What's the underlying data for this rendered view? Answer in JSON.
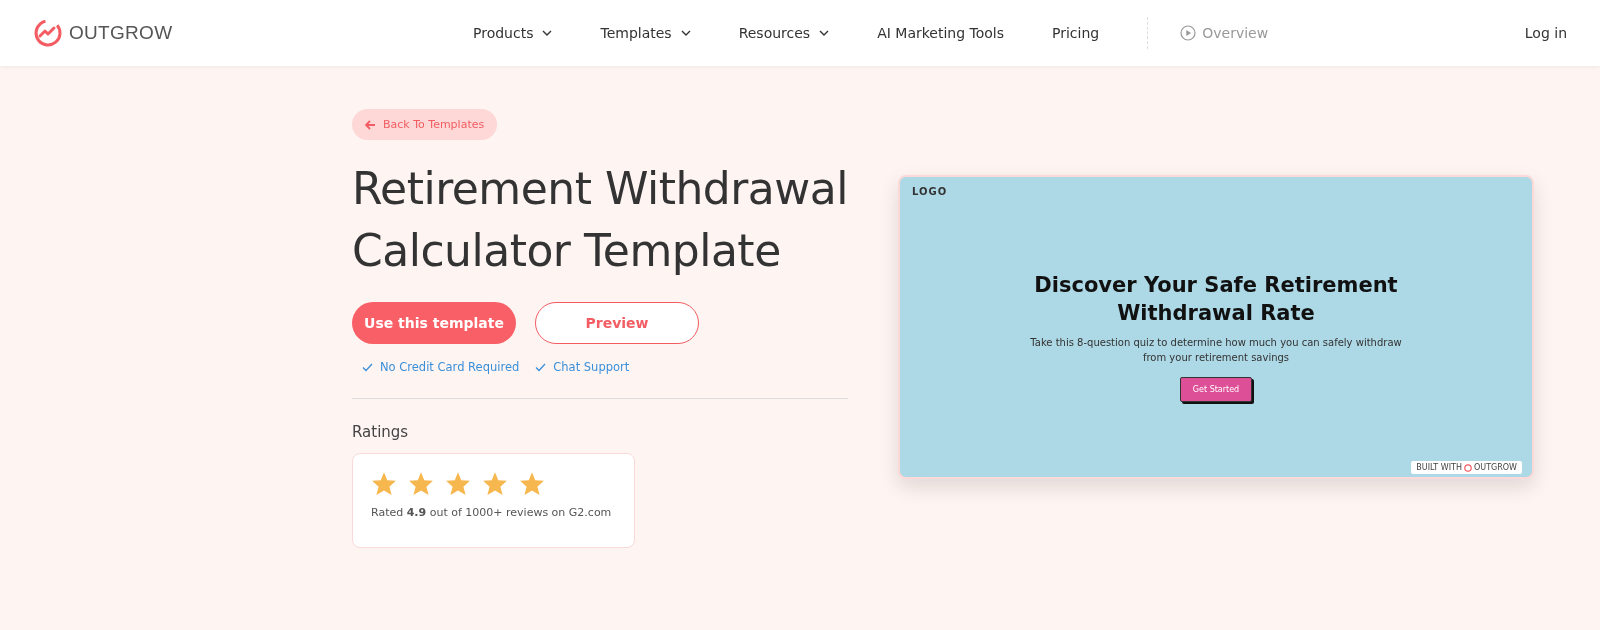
{
  "header": {
    "brand": "OUTGROW",
    "nav": [
      {
        "label": "Products",
        "kind": "dropdown"
      },
      {
        "label": "Templates",
        "kind": "dropdown"
      },
      {
        "label": "Resources",
        "kind": "dropdown"
      },
      {
        "label": "AI Marketing Tools",
        "kind": "link"
      },
      {
        "label": "Pricing",
        "kind": "link"
      },
      {
        "label": "Overview",
        "kind": "video"
      }
    ],
    "login": "Log in"
  },
  "back_link": "Back To Templates",
  "title": "Retirement Withdrawal Calculator Template",
  "buttons": [
    {
      "label": "Use this template",
      "kind": "primary"
    },
    {
      "label": "Preview",
      "kind": "outline"
    }
  ],
  "features": [
    "No Credit Card Required",
    "Chat Support"
  ],
  "ratings": {
    "heading": "Ratings",
    "stars": 5,
    "text": "Rated **4.9** out of 1000+ reviews on G2.com"
  },
  "preview": {
    "logo": "LOGO",
    "heading": "Discover Your Safe Retirement Withdrawal Rate",
    "subtitle": "Take this 8-question quiz to determine how much you can safely withdraw from your retirement savings",
    "button": "Get Started",
    "badge_prefix": "BUILT WITH",
    "badge_brand": "OUTGROW"
  }
}
